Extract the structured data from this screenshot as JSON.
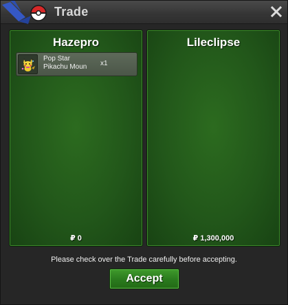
{
  "window": {
    "title": "Trade",
    "close_label": "✕"
  },
  "left_panel": {
    "player_name": "Hazepro",
    "items": [
      {
        "name_line1": "Pop Star",
        "name_line2": "Pikachu Moun",
        "quantity": "x1",
        "icon": "pikachu-sprite-icon"
      }
    ],
    "money": "₽ 0"
  },
  "right_panel": {
    "player_name": "Lileclipse",
    "items": [],
    "money": "₽ 1,300,000"
  },
  "notice": "Please check over the Trade carefully before accepting.",
  "accept_label": "Accept",
  "colors": {
    "panel_green": "#22571a",
    "button_green": "#2a7a1d",
    "window_bg": "#262626"
  }
}
